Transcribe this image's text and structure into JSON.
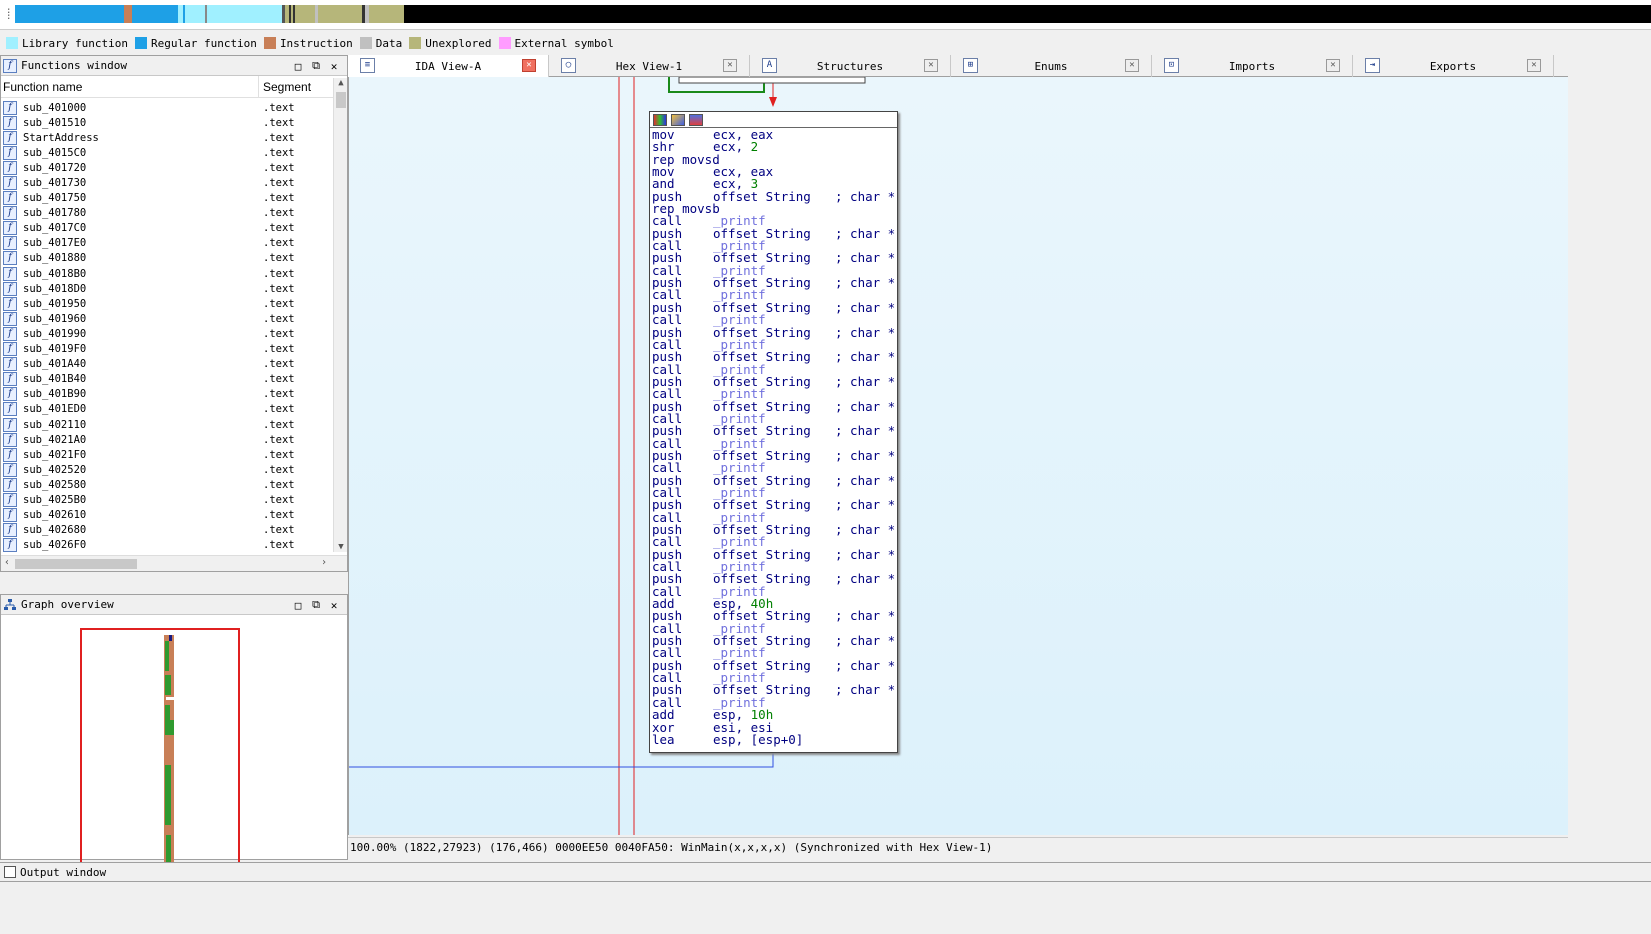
{
  "colors": {
    "library_function": "#a0f0ff",
    "regular_function": "#1ea0e6",
    "instruction": "#c87f57",
    "data": "#c0c0c0",
    "unexplored": "#b6b67a",
    "external_symbol": "#ff9cff",
    "selection_frame": "#e02020",
    "graph_edge_red": "#e02020",
    "graph_edge_blue": "#3050e0",
    "graph_edge_green": "#1a8a1a"
  },
  "legend": [
    {
      "label": "Library function",
      "color": "#a0f0ff"
    },
    {
      "label": "Regular function",
      "color": "#1ea0e6"
    },
    {
      "label": "Instruction",
      "color": "#c87f57"
    },
    {
      "label": "Data",
      "color": "#c0c0c0"
    },
    {
      "label": "Unexplored",
      "color": "#b6b67a"
    },
    {
      "label": "External symbol",
      "color": "#ff9cff"
    }
  ],
  "functions_window": {
    "title": "Functions window",
    "col_function": "Function name",
    "col_segment": "Segment",
    "rows": [
      {
        "name": "sub_401000",
        "segment": ".text"
      },
      {
        "name": "sub_401510",
        "segment": ".text"
      },
      {
        "name": "StartAddress",
        "segment": ".text"
      },
      {
        "name": "sub_4015C0",
        "segment": ".text"
      },
      {
        "name": "sub_401720",
        "segment": ".text"
      },
      {
        "name": "sub_401730",
        "segment": ".text"
      },
      {
        "name": "sub_401750",
        "segment": ".text"
      },
      {
        "name": "sub_401780",
        "segment": ".text"
      },
      {
        "name": "sub_4017C0",
        "segment": ".text"
      },
      {
        "name": "sub_4017E0",
        "segment": ".text"
      },
      {
        "name": "sub_401880",
        "segment": ".text"
      },
      {
        "name": "sub_4018B0",
        "segment": ".text"
      },
      {
        "name": "sub_4018D0",
        "segment": ".text"
      },
      {
        "name": "sub_401950",
        "segment": ".text"
      },
      {
        "name": "sub_401960",
        "segment": ".text"
      },
      {
        "name": "sub_401990",
        "segment": ".text"
      },
      {
        "name": "sub_4019F0",
        "segment": ".text"
      },
      {
        "name": "sub_401A40",
        "segment": ".text"
      },
      {
        "name": "sub_401B40",
        "segment": ".text"
      },
      {
        "name": "sub_401B90",
        "segment": ".text"
      },
      {
        "name": "sub_401ED0",
        "segment": ".text"
      },
      {
        "name": "sub_402110",
        "segment": ".text"
      },
      {
        "name": "sub_4021A0",
        "segment": ".text"
      },
      {
        "name": "sub_4021F0",
        "segment": ".text"
      },
      {
        "name": "sub_402520",
        "segment": ".text"
      },
      {
        "name": "sub_402580",
        "segment": ".text"
      },
      {
        "name": "sub_4025B0",
        "segment": ".text"
      },
      {
        "name": "sub_402610",
        "segment": ".text"
      },
      {
        "name": "sub_402680",
        "segment": ".text"
      },
      {
        "name": "sub_4026F0",
        "segment": ".text"
      }
    ]
  },
  "graph_overview": {
    "title": "Graph overview"
  },
  "tabs": [
    {
      "label": "IDA View-A",
      "icon": "ida-view-icon",
      "active": true
    },
    {
      "label": "Hex View-1",
      "icon": "hex-view-icon",
      "active": false
    },
    {
      "label": "Structures",
      "icon": "structures-icon",
      "active": false
    },
    {
      "label": "Enums",
      "icon": "enums-icon",
      "active": false
    },
    {
      "label": "Imports",
      "icon": "imports-icon",
      "active": false
    },
    {
      "label": "Exports",
      "icon": "exports-icon",
      "active": false
    }
  ],
  "disasm": [
    {
      "m": "mov",
      "o": "ecx, eax"
    },
    {
      "m": "shr",
      "o": "ecx, ",
      "n": "2"
    },
    {
      "m": "rep movsd",
      "o": ""
    },
    {
      "m": "mov",
      "o": "ecx, eax"
    },
    {
      "m": "and",
      "o": "ecx, ",
      "n": "3"
    },
    {
      "m": "push",
      "o": "offset String",
      "c": "; char *"
    },
    {
      "m": "rep movsb",
      "o": ""
    },
    {
      "m": "call",
      "l": "_printf"
    },
    {
      "m": "push",
      "o": "offset String",
      "c": "; char *"
    },
    {
      "m": "call",
      "l": "_printf"
    },
    {
      "m": "push",
      "o": "offset String",
      "c": "; char *"
    },
    {
      "m": "call",
      "l": "_printf"
    },
    {
      "m": "push",
      "o": "offset String",
      "c": "; char *"
    },
    {
      "m": "call",
      "l": "_printf"
    },
    {
      "m": "push",
      "o": "offset String",
      "c": "; char *"
    },
    {
      "m": "call",
      "l": "_printf"
    },
    {
      "m": "push",
      "o": "offset String",
      "c": "; char *"
    },
    {
      "m": "call",
      "l": "_printf"
    },
    {
      "m": "push",
      "o": "offset String",
      "c": "; char *"
    },
    {
      "m": "call",
      "l": "_printf"
    },
    {
      "m": "push",
      "o": "offset String",
      "c": "; char *"
    },
    {
      "m": "call",
      "l": "_printf"
    },
    {
      "m": "push",
      "o": "offset String",
      "c": "; char *"
    },
    {
      "m": "call",
      "l": "_printf"
    },
    {
      "m": "push",
      "o": "offset String",
      "c": "; char *"
    },
    {
      "m": "call",
      "l": "_printf"
    },
    {
      "m": "push",
      "o": "offset String",
      "c": "; char *"
    },
    {
      "m": "call",
      "l": "_printf"
    },
    {
      "m": "push",
      "o": "offset String",
      "c": "; char *"
    },
    {
      "m": "call",
      "l": "_printf"
    },
    {
      "m": "push",
      "o": "offset String",
      "c": "; char *"
    },
    {
      "m": "call",
      "l": "_printf"
    },
    {
      "m": "push",
      "o": "offset String",
      "c": "; char *"
    },
    {
      "m": "call",
      "l": "_printf"
    },
    {
      "m": "push",
      "o": "offset String",
      "c": "; char *"
    },
    {
      "m": "call",
      "l": "_printf"
    },
    {
      "m": "push",
      "o": "offset String",
      "c": "; char *"
    },
    {
      "m": "call",
      "l": "_printf"
    },
    {
      "m": "add",
      "o": "esp, ",
      "n": "40h"
    },
    {
      "m": "push",
      "o": "offset String",
      "c": "; char *"
    },
    {
      "m": "call",
      "l": "_printf"
    },
    {
      "m": "push",
      "o": "offset String",
      "c": "; char *"
    },
    {
      "m": "call",
      "l": "_printf"
    },
    {
      "m": "push",
      "o": "offset String",
      "c": "; char *"
    },
    {
      "m": "call",
      "l": "_printf"
    },
    {
      "m": "push",
      "o": "offset String",
      "c": "; char *"
    },
    {
      "m": "call",
      "l": "_printf"
    },
    {
      "m": "add",
      "o": "esp, ",
      "n": "10h"
    },
    {
      "m": "xor",
      "o": "esi, esi"
    },
    {
      "m": "lea",
      "o": "esp, [esp+0]"
    }
  ],
  "status_bar": "100.00% (1822,27923) (176,466) 0000EE50 0040FA50: WinMain(x,x,x,x) (Synchronized with Hex View-1)",
  "output_window": {
    "title": "Output window"
  }
}
